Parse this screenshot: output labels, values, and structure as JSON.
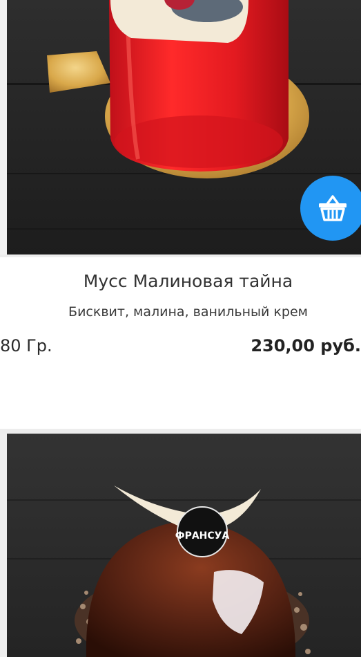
{
  "products": [
    {
      "title": "Мусс Малиновая тайна",
      "description": "Бисквит, малина, ванильный крем",
      "weight": "80 Гр.",
      "price": "230,00 руб."
    },
    {
      "logo_text": "ФРАНСУА"
    }
  ],
  "colors": {
    "accent": "#2196f3",
    "cake_red": "#e01b22",
    "cake_chocolate": "#5a2414"
  },
  "icons": {
    "basket": "shopping-basket-icon"
  }
}
